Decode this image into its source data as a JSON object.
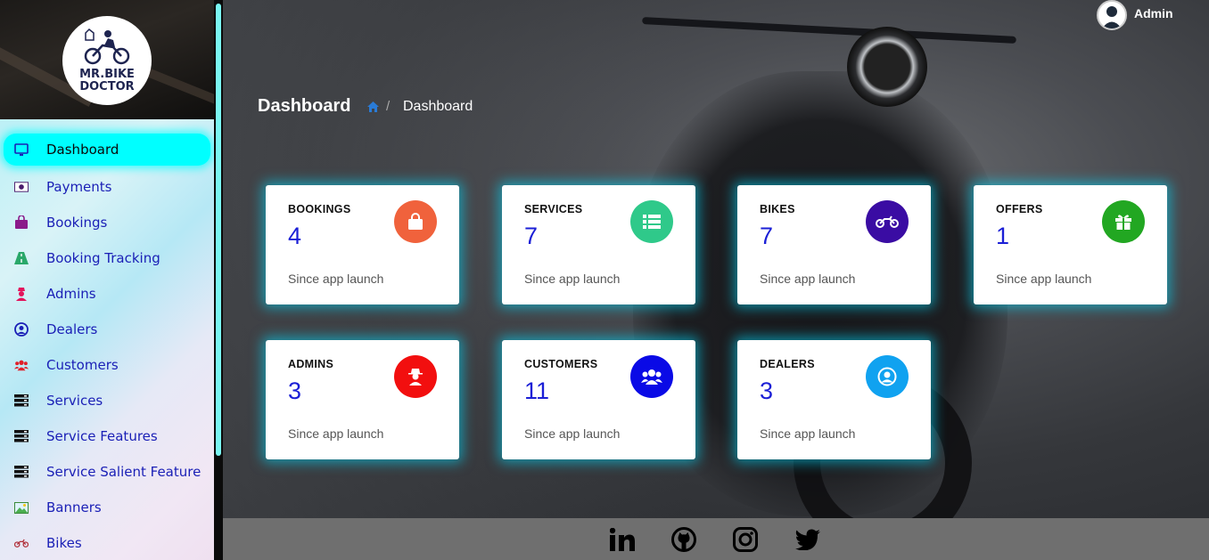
{
  "app": {
    "logo_text_line1": "MR.BIKE",
    "logo_text_line2": "DOCTOR"
  },
  "sidebar": {
    "items": [
      {
        "label": "Dashboard",
        "icon": "monitor-icon",
        "active": true
      },
      {
        "label": "Payments",
        "icon": "money-icon"
      },
      {
        "label": "Bookings",
        "icon": "shopping-bag-icon"
      },
      {
        "label": "Booking Tracking",
        "icon": "road-icon"
      },
      {
        "label": "Admins",
        "icon": "user-secret-icon"
      },
      {
        "label": "Dealers",
        "icon": "user-circle-icon"
      },
      {
        "label": "Customers",
        "icon": "users-icon"
      },
      {
        "label": "Services",
        "icon": "server-icon"
      },
      {
        "label": "Service Features",
        "icon": "server-icon"
      },
      {
        "label": "Service Salient Feature",
        "icon": "server-icon"
      },
      {
        "label": "Banners",
        "icon": "image-icon"
      },
      {
        "label": "Bikes",
        "icon": "motorcycle-icon"
      }
    ]
  },
  "topbar": {
    "user_name": "Admin"
  },
  "header": {
    "title": "Dashboard",
    "breadcrumb_current": "Dashboard",
    "breadcrumb_separator": "/"
  },
  "cards": [
    {
      "title": "BOOKINGS",
      "value": "4",
      "subtitle": "Since app launch",
      "icon": "shopping-bag-icon",
      "color": "#f0623c"
    },
    {
      "title": "SERVICES",
      "value": "7",
      "subtitle": "Since app launch",
      "icon": "list-icon",
      "color": "#2fc98a"
    },
    {
      "title": "BIKES",
      "value": "7",
      "subtitle": "Since app launch",
      "icon": "motorcycle-icon",
      "color": "#3a0ca3"
    },
    {
      "title": "OFFERS",
      "value": "1",
      "subtitle": "Since app launch",
      "icon": "gift-icon",
      "color": "#22a722"
    },
    {
      "title": "ADMINS",
      "value": "3",
      "subtitle": "Since app launch",
      "icon": "user-secret-icon",
      "color": "#f20f0f"
    },
    {
      "title": "CUSTOMERS",
      "value": "11",
      "subtitle": "Since app launch",
      "icon": "users-icon",
      "color": "#0a0ae6"
    },
    {
      "title": "DEALERS",
      "value": "3",
      "subtitle": "Since app launch",
      "icon": "user-circle-icon",
      "color": "#10a2f0"
    }
  ],
  "footer": {
    "social": [
      "linkedin-icon",
      "github-icon",
      "instagram-icon",
      "twitter-icon"
    ]
  }
}
